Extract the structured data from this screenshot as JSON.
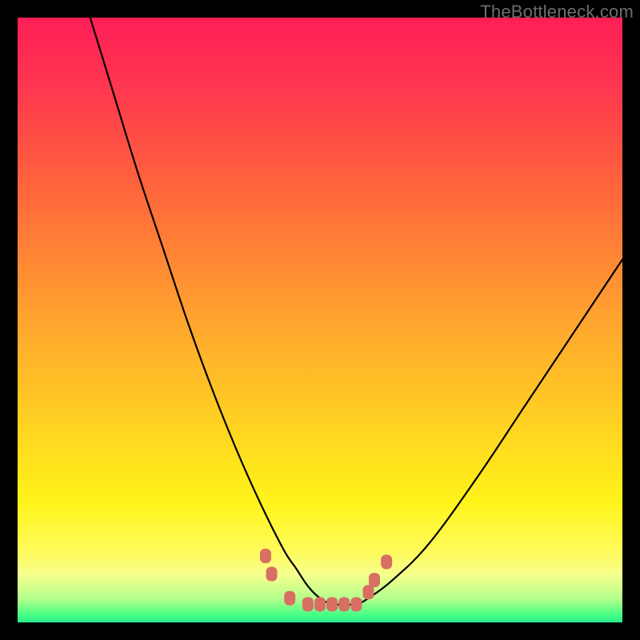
{
  "watermark": "TheBottleneck.com",
  "chart_data": {
    "type": "line",
    "title": "",
    "xlabel": "",
    "ylabel": "",
    "xlim": [
      0,
      100
    ],
    "ylim": [
      0,
      100
    ],
    "series": [
      {
        "name": "bottleneck-curve",
        "x": [
          12,
          16,
          20,
          24,
          28,
          32,
          36,
          40,
          44,
          46,
          48,
          50,
          52,
          54,
          56,
          58,
          62,
          68,
          76,
          84,
          92,
          100
        ],
        "values": [
          100,
          87,
          74,
          62,
          50,
          39,
          29,
          20,
          12,
          9,
          6,
          4,
          3,
          3,
          3,
          4,
          7,
          13,
          24,
          36,
          48,
          60
        ]
      }
    ],
    "markers": {
      "name": "bottom-dots",
      "color": "#d96e63",
      "points": [
        {
          "x": 41,
          "y": 11
        },
        {
          "x": 42,
          "y": 8
        },
        {
          "x": 45,
          "y": 4
        },
        {
          "x": 48,
          "y": 3
        },
        {
          "x": 50,
          "y": 3
        },
        {
          "x": 52,
          "y": 3
        },
        {
          "x": 54,
          "y": 3
        },
        {
          "x": 56,
          "y": 3
        },
        {
          "x": 58,
          "y": 5
        },
        {
          "x": 59,
          "y": 7
        },
        {
          "x": 61,
          "y": 10
        }
      ]
    },
    "gradient_bands": [
      {
        "color": "#ff1f57",
        "stop": 0
      },
      {
        "color": "#ffa42e",
        "stop": 50
      },
      {
        "color": "#fff319",
        "stop": 80
      },
      {
        "color": "#3fff85",
        "stop": 99
      }
    ]
  }
}
